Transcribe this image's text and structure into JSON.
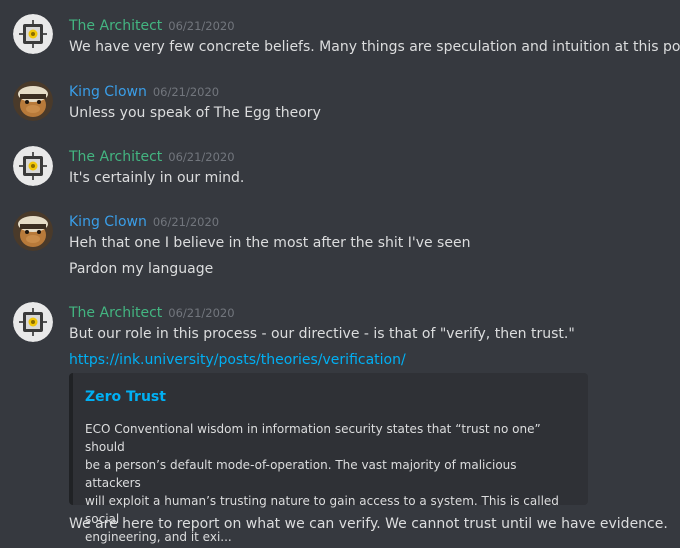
{
  "messages": [
    {
      "author": "The Architect",
      "timestamp": "06/21/2020",
      "avatar_icon": "robot-bot-icon",
      "lines": [
        "We have very few concrete beliefs. Many things are speculation and intuition at this point."
      ]
    },
    {
      "author": "King Clown",
      "timestamp": "06/21/2020",
      "avatar_icon": "clown-avatar-icon",
      "lines": [
        "Unless you speak of The Egg theory"
      ]
    },
    {
      "author": "The Architect",
      "timestamp": "06/21/2020",
      "avatar_icon": "robot-bot-icon",
      "lines": [
        "It's certainly in our mind."
      ]
    },
    {
      "author": "King Clown",
      "timestamp": "06/21/2020",
      "avatar_icon": "clown-avatar-icon",
      "lines": [
        "Heh that one I believe in the most after the shit I've seen",
        "Pardon my language"
      ]
    },
    {
      "author": "The Architect",
      "timestamp": "06/21/2020",
      "avatar_icon": "robot-bot-icon",
      "lines": [
        "But our role in this process - our directive - is that of \"verify, then trust.\""
      ],
      "link": "https://ink.university/posts/theories/verification/",
      "embed": {
        "title": "Zero Trust",
        "description_lines": [
          "ECO Conventional wisdom in information security states that “trust no one” should",
          "be a person’s default mode-of-operation. The vast majority of malicious attackers",
          "will exploit a human’s trusting nature to gain access to a system. This is called social",
          "engineering, and it exi..."
        ]
      },
      "after": "We are here to report on what we can verify. We cannot trust until we have evidence."
    }
  ],
  "colors": {
    "background": "#36393f",
    "architect_name": "#43b581",
    "clown_name": "#3a9ee8",
    "link": "#00b0f4",
    "timestamp": "#72767d",
    "embed_bg": "#2f3136"
  }
}
